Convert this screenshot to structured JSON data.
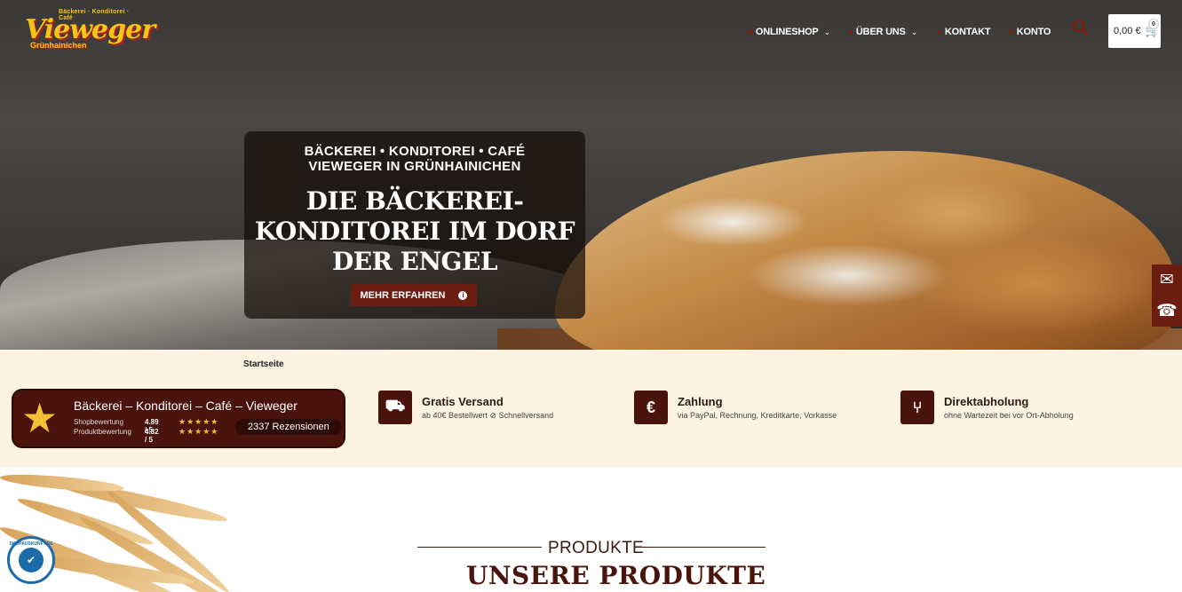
{
  "header": {
    "logo": {
      "top_text": "Bäckerei · Konditorei · Café",
      "name": "Vieweger",
      "place": "Grünhainichen"
    },
    "nav": [
      {
        "label": "ONLINESHOP",
        "icon": "basket-icon",
        "has_dropdown": true
      },
      {
        "label": "ÜBER UNS",
        "icon": "people-icon",
        "has_dropdown": true
      },
      {
        "label": "KONTAKT",
        "icon": "user-icon",
        "has_dropdown": false
      },
      {
        "label": "KONTO",
        "icon": "heart-icon",
        "has_dropdown": false
      }
    ],
    "cart": {
      "total": "0,00 €",
      "count": "0"
    }
  },
  "hero": {
    "kicker_line1": "BÄCKEREI • KONDITOREI • CAFÉ",
    "kicker_line2": "VIEWEGER IN GRÜNHAINICHEN",
    "headline": "DIE BÄCKEREI-KONDITOREI IM DORF DER ENGEL",
    "cta_label": "MEHR ERFAHREN"
  },
  "breadcrumb": "Startseite",
  "rating": {
    "title": "Bäckerei – Konditorei – Café – Vieweger",
    "shop_label": "Shopbewertung",
    "shop_value": "4.89 / 5",
    "product_label": "Produktbewertung",
    "product_value": "4.82 / 5",
    "reviews": "2337 Rezensionen"
  },
  "features": [
    {
      "title": "Gratis Versand",
      "subtitle": "ab 40€ Bestellwert ⊘ Schnellversand",
      "icon": "truck-icon"
    },
    {
      "title": "Zahlung",
      "subtitle": "via PayPal, Rechnung, Kreditkarte, Vorkasse",
      "icon": "euro-icon"
    },
    {
      "title": "Direktabholung",
      "subtitle": "ohne Wartezeit bei vor Ort-Abholung",
      "icon": "basket-icon"
    }
  ],
  "products": {
    "kicker": "PRODUKTE",
    "title": "UNSERE PRODUKTE"
  },
  "badge": {
    "label": "SHOPAUSKUNFT.DE"
  },
  "colors": {
    "brand": "#4a130b",
    "accent": "#f5c518",
    "bar_bg": "#fdf3e3"
  }
}
